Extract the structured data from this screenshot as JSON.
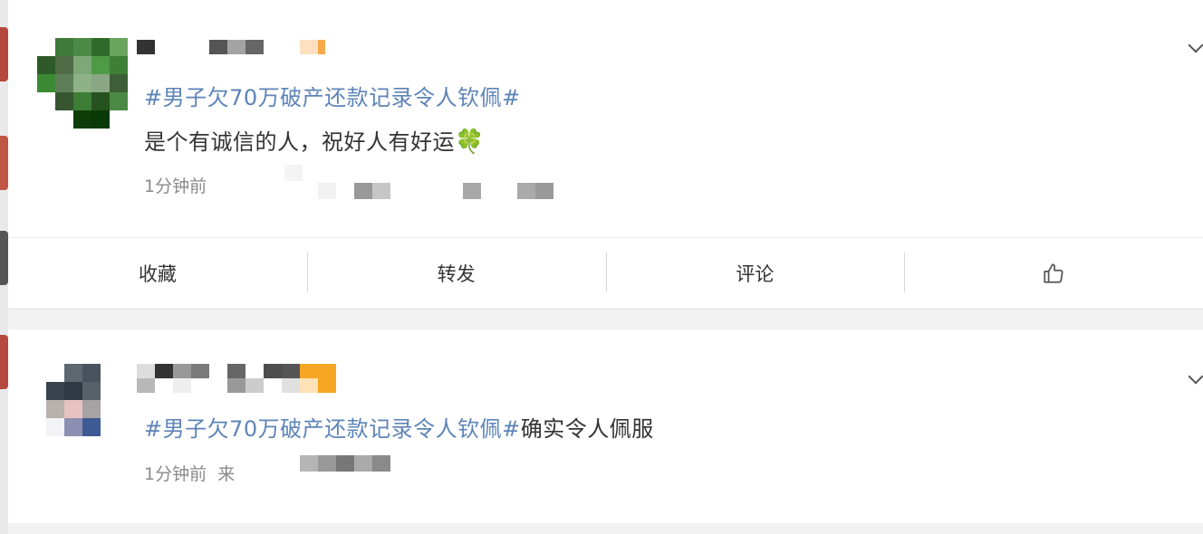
{
  "posts": [
    {
      "topic": "#男子欠70万破产还款记录令人钦佩#",
      "text": "是个有诚信的人，祝好人有好运",
      "emoji": "🍀",
      "meta": "1分钟前",
      "actions": {
        "favorite": "收藏",
        "repost": "转发",
        "comment": "评论"
      }
    },
    {
      "topic": "#男子欠70万破产还款记录令人钦佩#",
      "text": "确实令人佩服",
      "meta": "1分钟前",
      "source": "来"
    }
  ],
  "icons": {
    "like": "thumbs-up-icon",
    "expand": "chevron-down-icon",
    "emoji": "four-leaf-clover-icon"
  }
}
